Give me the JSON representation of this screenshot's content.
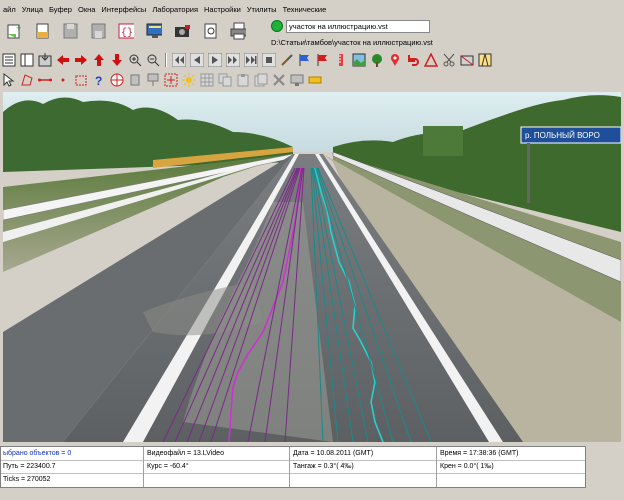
{
  "menu": [
    "айл",
    "Улица",
    "Буфер",
    "Окна",
    "Интерфейсы",
    "Лаборатория",
    "Настройки",
    "Утилиты",
    "Технические"
  ],
  "file": {
    "name": "участок на иллюстрацию.vst",
    "path": "D:\\Статьи\\тамбов\\участок на иллюстрацию.vst"
  },
  "road_sign": "р. ПОЛЬНЫЙ ВОРО",
  "status": {
    "selected": "ыбрано объектов = 0",
    "video": "Видеофайл = 13.LVideo",
    "date": "Дата = 10.08.2011 (GMT)",
    "time": "Время = 17:38:36 (GMT)",
    "path": "Путь = 223400.7",
    "course": "Курс = -60.4°",
    "pitch": "Тангаж = 0.3°(  4‰)",
    "roll": "Крен = 0.0°(  1‰)",
    "ticks": "Ticks = 270052"
  },
  "colors": {
    "magenta": "#d030d0",
    "purple": "#7a2a86",
    "teal": "#1a8a8a",
    "cyan": "#28d0d0",
    "status_blue": "#1030c0"
  }
}
